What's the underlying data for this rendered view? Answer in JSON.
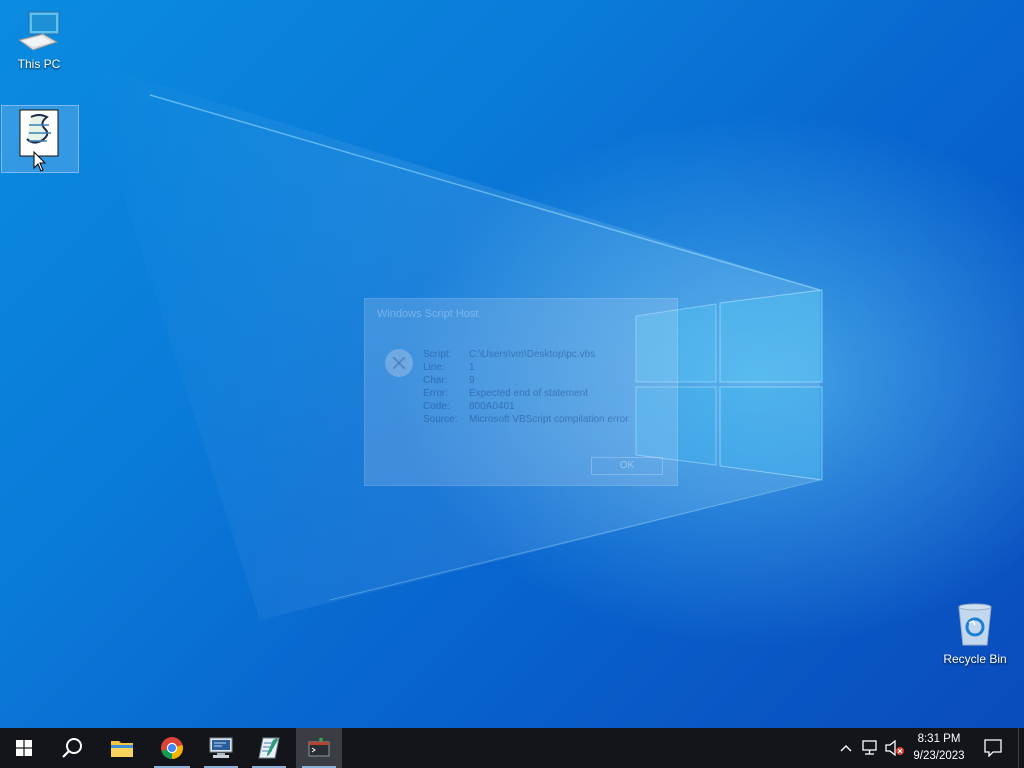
{
  "desktop": {
    "icons": [
      {
        "label": "This PC",
        "icon": "computer-icon"
      },
      {
        "label": "",
        "icon": "vbscript-file-icon",
        "selected": true
      },
      {
        "label": "Recycle Bin",
        "icon": "recycle-bin-icon"
      }
    ]
  },
  "dialog": {
    "title": "Windows Script Host",
    "rows": [
      {
        "key": "Script:",
        "value": "C:\\Users\\vm\\Desktop\\pc.vbs"
      },
      {
        "key": "Line:",
        "value": "1"
      },
      {
        "key": "Char:",
        "value": "9"
      },
      {
        "key": "Error:",
        "value": "Expected end of statement"
      },
      {
        "key": "Code:",
        "value": "800A0401"
      },
      {
        "key": "Source:",
        "value": "Microsoft VBScript compilation error"
      }
    ],
    "ok_label": "OK",
    "icon": "error-icon"
  },
  "taskbar": {
    "start": "windows-start-icon",
    "search": "search-icon",
    "apps": [
      {
        "name": "file-explorer",
        "icon": "folder-icon"
      },
      {
        "name": "chrome",
        "icon": "chrome-icon",
        "running": true
      },
      {
        "name": "remote-desktop",
        "icon": "computer-monitor-icon",
        "running": true
      },
      {
        "name": "notepad",
        "icon": "notepad-icon",
        "running": true
      },
      {
        "name": "terminal",
        "icon": "terminal-icon",
        "running": true,
        "active": true
      }
    ],
    "tray": {
      "chevron": "chevron-up-icon",
      "network": "network-icon",
      "volume": "volume-muted-icon",
      "time": "8:31 PM",
      "date": "9/23/2023",
      "notifications": "notification-icon"
    }
  },
  "colors": {
    "accent": "#0a78d7",
    "taskbar": "#13151a",
    "running_indicator": "#8bb3d9"
  }
}
